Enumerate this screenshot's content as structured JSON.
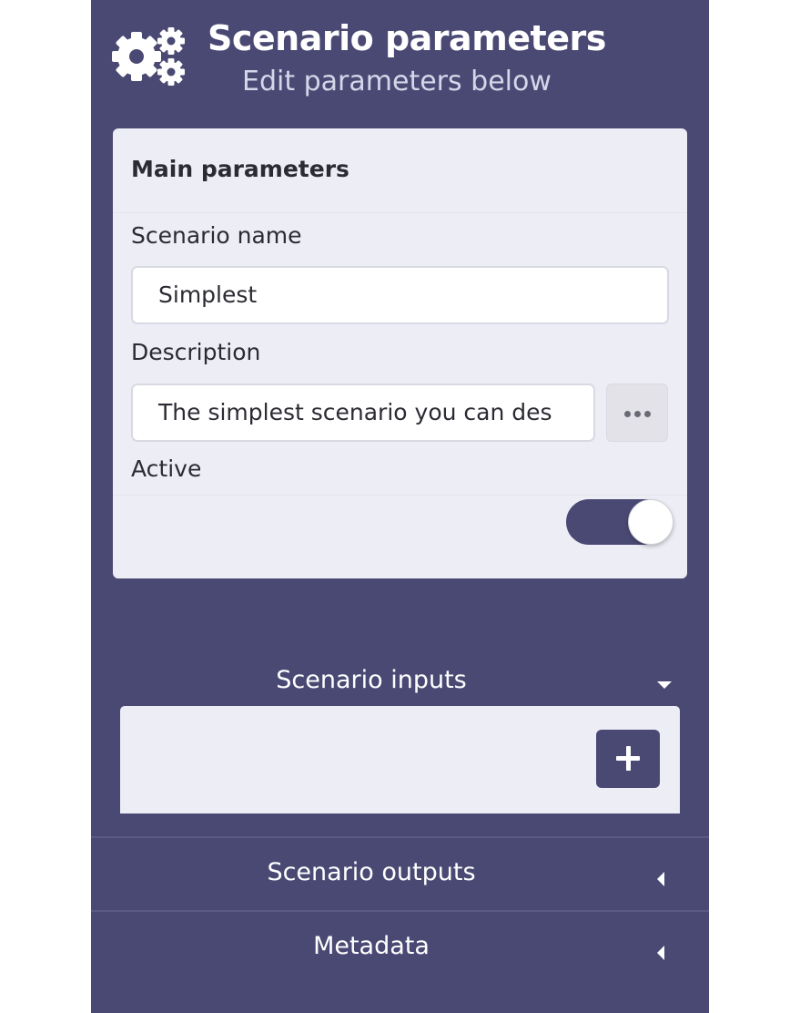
{
  "header": {
    "title": "Scenario parameters",
    "subtitle": "Edit parameters below",
    "icon": "gears-icon"
  },
  "main_parameters": {
    "title": "Main parameters",
    "scenario_name": {
      "label": "Scenario name",
      "value": "Simplest"
    },
    "description": {
      "label": "Description",
      "value": "The simplest scenario you can des",
      "more_icon": "ellipsis-icon"
    },
    "active": {
      "label": "Active",
      "checked": true
    }
  },
  "sections": {
    "inputs": {
      "title": "Scenario inputs",
      "expanded": true,
      "add_icon": "plus-icon"
    },
    "outputs": {
      "title": "Scenario outputs",
      "expanded": false
    },
    "metadata": {
      "title": "Metadata",
      "expanded": false
    }
  },
  "colors": {
    "panel_background": "#4a4974",
    "card_background": "#ededf6",
    "accent": "#4a4974"
  }
}
